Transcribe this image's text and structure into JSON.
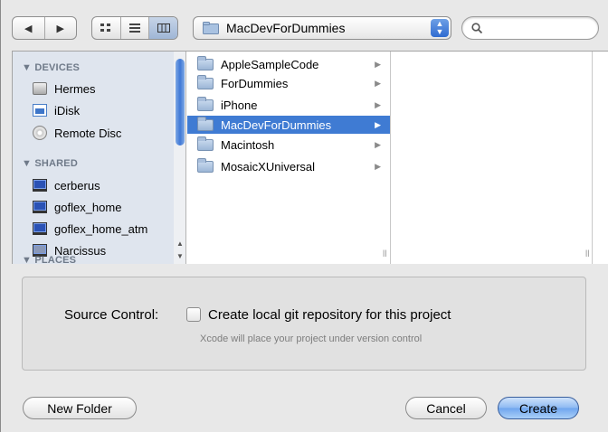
{
  "toolbar": {
    "back_icon": "◀",
    "forward_icon": "▶",
    "view_icons": [
      "grid",
      "list",
      "columns"
    ],
    "path": "MacDevForDummies",
    "search_placeholder": ""
  },
  "sidebar": {
    "sections": [
      {
        "title": "▼ DEVICES",
        "items": [
          {
            "label": "Hermes",
            "icon": "hard-drive"
          },
          {
            "label": "iDisk",
            "icon": "idisk"
          },
          {
            "label": "Remote Disc",
            "icon": "disc"
          }
        ]
      },
      {
        "title": "▼ SHARED",
        "items": [
          {
            "label": "cerberus",
            "icon": "monitor"
          },
          {
            "label": "goflex_home",
            "icon": "monitor"
          },
          {
            "label": "goflex_home_atm",
            "icon": "monitor"
          },
          {
            "label": "Narcissus",
            "icon": "monitor"
          }
        ]
      },
      {
        "title": "▼ PLACES",
        "items": []
      }
    ]
  },
  "column1": {
    "items": [
      {
        "label": "AppleSampleCode",
        "selected": false
      },
      {
        "label": "ForDummies",
        "selected": false
      },
      {
        "label": "iPhone",
        "selected": false
      },
      {
        "label": "MacDevForDummies",
        "selected": true
      },
      {
        "label": "Macintosh",
        "selected": false
      },
      {
        "label": "MosaicXUniversal",
        "selected": false
      }
    ]
  },
  "options": {
    "source_control_label": "Source Control:",
    "checkbox_label": "Create local git repository for this project",
    "checkbox_checked": false,
    "hint": "Xcode will place your project under version control"
  },
  "buttons": {
    "new_folder": "New Folder",
    "cancel": "Cancel",
    "create": "Create"
  },
  "colors": {
    "selection": "#3f7bd3",
    "sidebar_bg": "#dfe5ee"
  }
}
